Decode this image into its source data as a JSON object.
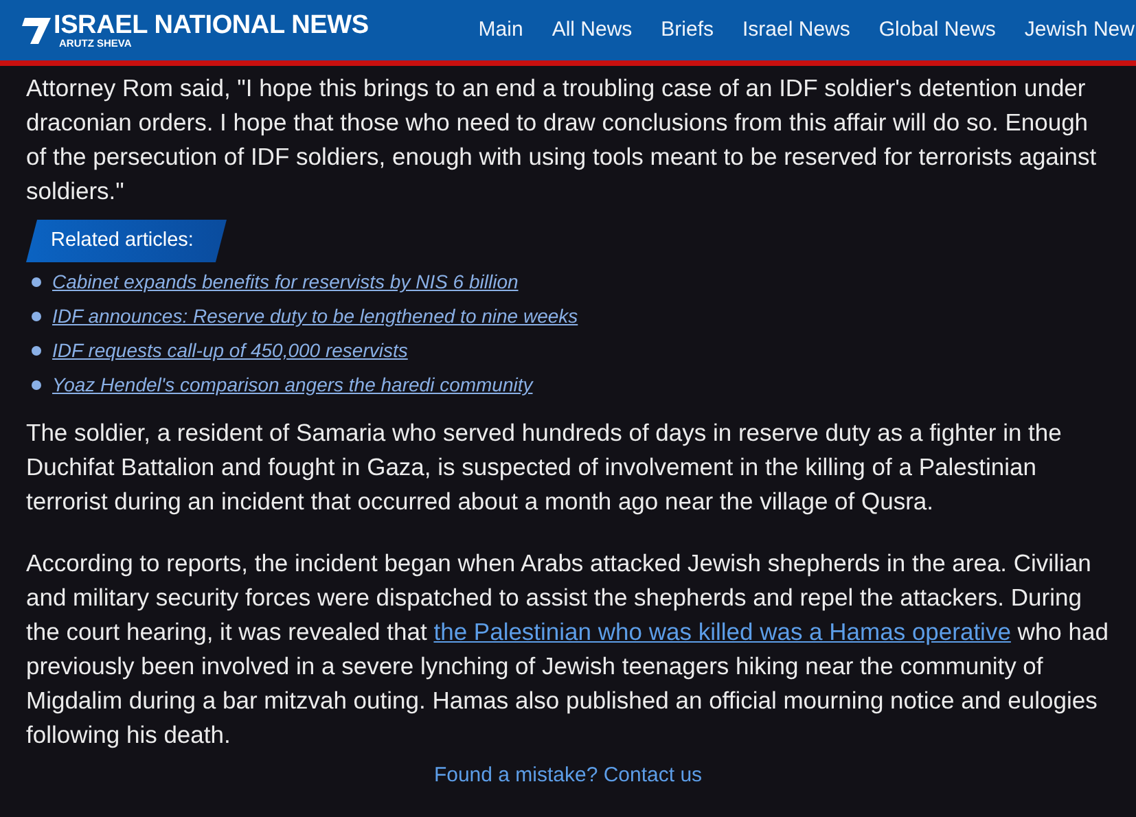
{
  "header": {
    "logo_title": "ISRAEL NATIONAL NEWS",
    "logo_subtitle": "ARUTZ SHEVA",
    "nav": [
      {
        "label": "Main"
      },
      {
        "label": "All News"
      },
      {
        "label": "Briefs"
      },
      {
        "label": "Israel News"
      },
      {
        "label": "Global News"
      },
      {
        "label": "Jewish New"
      }
    ]
  },
  "article": {
    "quote_paragraph": "Attorney Rom said, \"I hope this brings to an end a troubling case of an IDF soldier's detention under draconian orders. I hope that those who need to draw conclusions from this affair will do so. Enough of the persecution of IDF soldiers, enough with using tools meant to be reserved for terrorists against soldiers.\"",
    "related": {
      "title": "Related articles:",
      "items": [
        {
          "label": "Cabinet expands benefits for reservists by NIS 6 billion"
        },
        {
          "label": "IDF announces: Reserve duty to be lengthened to nine weeks"
        },
        {
          "label": "IDF requests call-up of 450,000 reservists"
        },
        {
          "label": "Yoaz Hendel's comparison angers the haredi community"
        }
      ]
    },
    "paragraphs": [
      {
        "text": "The soldier, a resident of Samaria who served hundreds of days in reserve duty as a fighter in the Duchifat Battalion and fought in Gaza, is suspected of involvement in the killing of a Palestinian terrorist during an incident that occurred about a month ago near the village of Qusra."
      },
      {
        "text": "According to reports, the incident began when Arabs attacked Jewish shepherds in the area. Civilian and military security forces were dispatched to assist the shepherds and repel the attackers. During the court hearing, it was revealed that",
        "link": "the Palestinian who was killed was a Hamas operative",
        "text_after": "who had previously been involved in a severe lynching of Jewish teenagers hiking near the community of Migdalim during a bar mitzvah outing. Hamas also published an official mourning notice and eulogies following his death."
      }
    ],
    "footer_link": "Found a mistake? Contact us"
  }
}
